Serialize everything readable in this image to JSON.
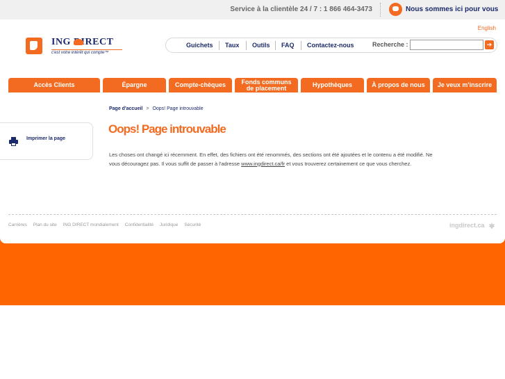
{
  "topbar": {
    "service": "Service à la clientèle 24 / 7 : 1 866 464-3473",
    "chat": "Nous sommes ici pour vous"
  },
  "lang": "English",
  "logo": {
    "name": "ING DIRECT",
    "tagline": "c'est votre intérêt qui compte™"
  },
  "utilnav": {
    "items": [
      "Guichets",
      "Taux",
      "Outils",
      "FAQ",
      "Contactez-nous"
    ],
    "search_label": "Recherche :",
    "search_value": "",
    "search_button": "➔"
  },
  "mainnav": {
    "tabs": [
      "Accès Clients",
      "Épargne",
      "Compte-chèques",
      "Fonds communs de placement",
      "Hypothèques",
      "À propos de nous",
      "Je veux m'inscrire"
    ]
  },
  "sidebar": {
    "print": "Imprimer la page"
  },
  "breadcrumb": {
    "home": "Page d'accueil",
    "sep": ">",
    "current": "Oops! Page introuvable"
  },
  "content": {
    "title": "Oops! Page introuvable",
    "text_before": "Les choses ont changé ici récemment. En effet, des fichiers ont été renommés, des sections ont été ajoutées et le contenu a été modifié. Ne vous découragez pas. Il vous suffit de passer à l'adresse ",
    "link": "www.ingdirect.ca/fr",
    "text_after": " et vous trouverez certainement ce que vous cherchez."
  },
  "footer": {
    "links": [
      "Carrières",
      "Plan du site",
      "ING DIRECT mondialement",
      "Confidentialité",
      "Juridique",
      "Sécurité"
    ],
    "brand": "ingdirect.ca"
  },
  "colors": {
    "accent": "#f26b21",
    "navy": "#1b2a6b",
    "band": "#ff6600"
  }
}
